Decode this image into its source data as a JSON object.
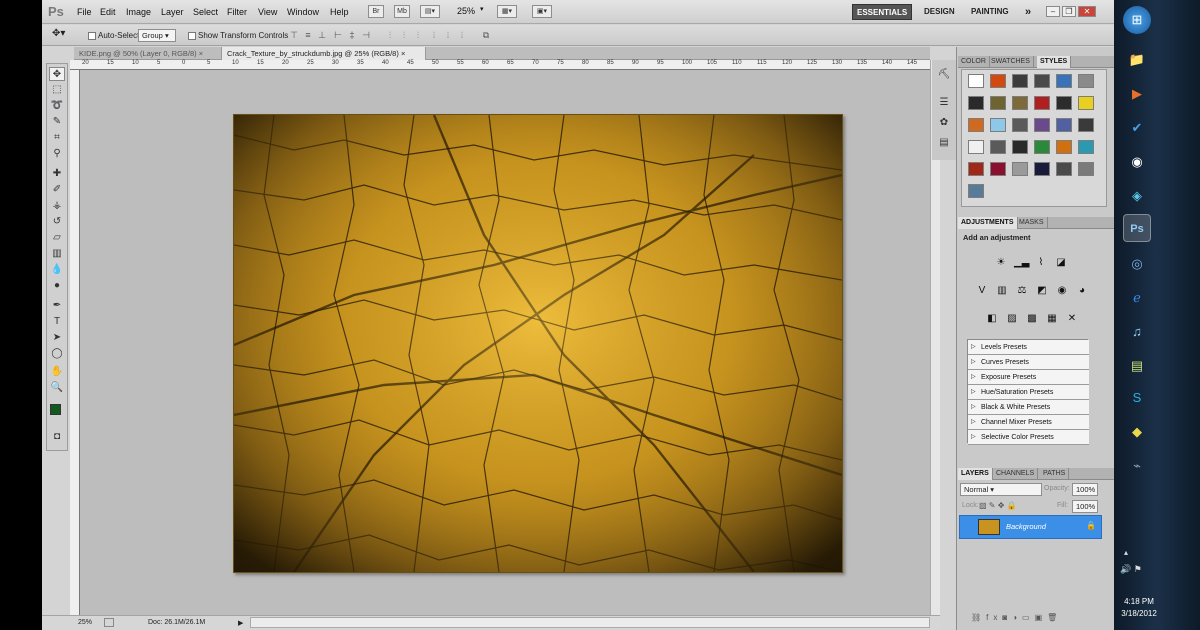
{
  "app": {
    "logo": "Ps",
    "menu": [
      "File",
      "Edit",
      "Image",
      "Layer",
      "Select",
      "Filter",
      "View",
      "Window",
      "Help"
    ],
    "zoom": "25%",
    "workspaces": [
      "ESSENTIALS",
      "DESIGN",
      "PAINTING"
    ],
    "more_workspaces": "»"
  },
  "options_bar": {
    "auto_select_label": "Auto-Select:",
    "auto_select_value": "Group",
    "show_transform_label": "Show Transform Controls"
  },
  "doc_tabs": [
    {
      "label": "KIDE.png @ 50% (Layer 0, RGB/8)",
      "close": "×",
      "active": false
    },
    {
      "label": "Crack_Texture_by_struckdumb.jpg @ 25% (RGB/8)",
      "close": "×",
      "active": true
    }
  ],
  "ruler_ticks": [
    "20",
    "15",
    "10",
    "5",
    "0",
    "5",
    "10",
    "15",
    "20",
    "25",
    "30",
    "35",
    "40",
    "45",
    "50",
    "55",
    "60",
    "65",
    "70",
    "75",
    "80",
    "85",
    "90",
    "95",
    "100",
    "105",
    "110",
    "115",
    "120",
    "125",
    "130",
    "135",
    "140",
    "145"
  ],
  "status": {
    "zoom": "25%",
    "doc_info": "Doc: 26.1M/26.1M"
  },
  "panels": {
    "color_tabs": [
      "COLOR",
      "SWATCHES",
      "STYLES"
    ],
    "styles_swatches": [
      "#ffffff",
      "#d24a10",
      "#3c3c3c",
      "#4a4a4a",
      "#3a72b8",
      "#8a8a8a",
      "#2a2a2a",
      "#6e6430",
      "#7c6a3a",
      "#b02020",
      "#2c2c2c",
      "#e8d020",
      "#d06a20",
      "#8ec8e8",
      "#5a5a5a",
      "#6a4a8a",
      "#5060a0",
      "#3a3a3a",
      "#f0f0f0",
      "#5a5a5a",
      "#2a2a2a",
      "#2a8a3a",
      "#d07010",
      "#2a9ab0",
      "#a02818",
      "#8a1030",
      "#9a9a9a",
      "#1a1a3a",
      "#4a4a4a",
      "#7a7a7a",
      "#5a7a9a"
    ],
    "adjust_tabs": [
      "ADJUSTMENTS",
      "MASKS"
    ],
    "adjust_title": "Add an adjustment",
    "presets": [
      "Levels Presets",
      "Curves Presets",
      "Exposure Presets",
      "Hue/Saturation Presets",
      "Black & White Presets",
      "Channel Mixer Presets",
      "Selective Color Presets"
    ],
    "layers_tabs": [
      "LAYERS",
      "CHANNELS",
      "PATHS"
    ],
    "blend_mode": "Normal",
    "opacity_label": "Opacity:",
    "opacity_value": "100%",
    "lock_label": "Lock:",
    "fill_label": "Fill:",
    "fill_value": "100%",
    "layer_name": "Background"
  },
  "taskbar": {
    "time": "4:18 PM",
    "date": "3/18/2012"
  }
}
